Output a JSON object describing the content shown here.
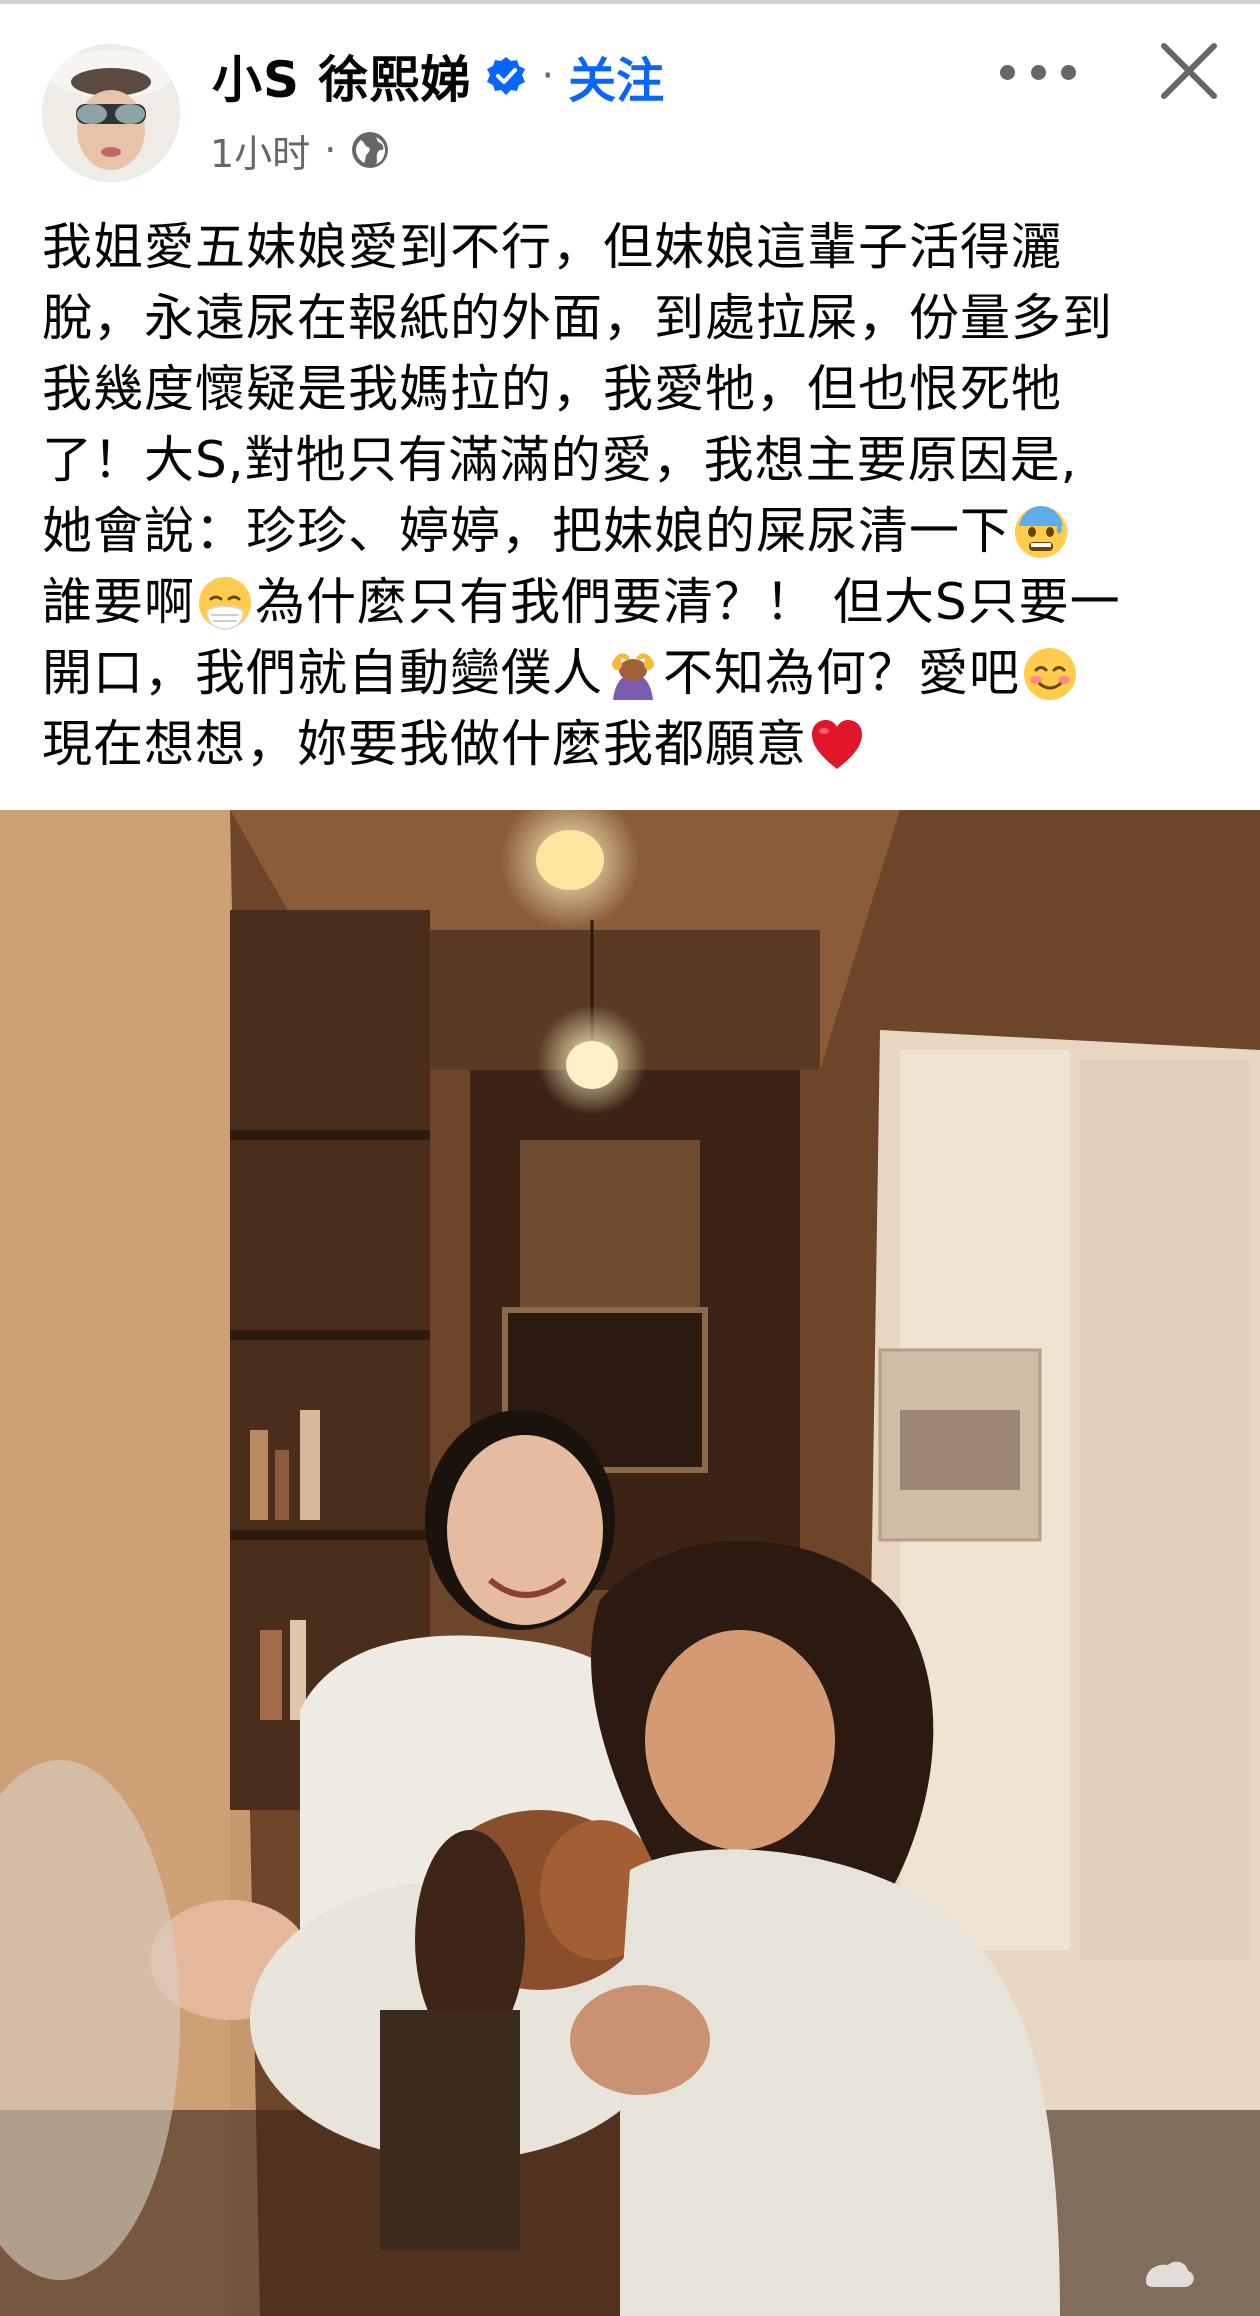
{
  "post": {
    "author_name": "小S 徐熙娣",
    "separator": "·",
    "follow_label": "关注",
    "time": "1小时",
    "meta_separator": "·",
    "text_lines": [
      {
        "text": "我姐愛五妹娘愛到不行，但妹娘這輩子活得灑"
      },
      {
        "text": "脫，永遠尿在報紙的外面，到處拉屎，份量多到"
      },
      {
        "text": "我幾度懷疑是我媽拉的，我愛牠，但也恨死牠"
      },
      {
        "text": "了！大S,對牠只有滿滿的愛，我想主要原因是,"
      },
      {
        "text": "她會說：珍珍、婷婷，把妹娘的屎尿清一下",
        "emoji_after": "anxious-sweat-emoji"
      },
      {
        "text": "誰要啊",
        "emoji_after": "sneezing-face-emoji",
        "text2": "為什麼只有我們要清？！ 但大S只要一"
      },
      {
        "text": "開口，我們就自動變僕人",
        "emoji_after": "person-bowing-emoji",
        "text2": "不知為何？愛吧",
        "emoji_end": "smiling-face-emoji"
      },
      {
        "text": "現在想想，妳要我做什麼我都願意",
        "emoji_after": "red-heart-emoji"
      }
    ]
  },
  "icons": {
    "verified": "verified-badge-icon",
    "globe": "public-globe-icon",
    "more": "more-options-icon",
    "close": "close-icon"
  },
  "colors": {
    "link_blue": "#0866ff",
    "secondary_text": "#65676b",
    "text": "#050505"
  }
}
